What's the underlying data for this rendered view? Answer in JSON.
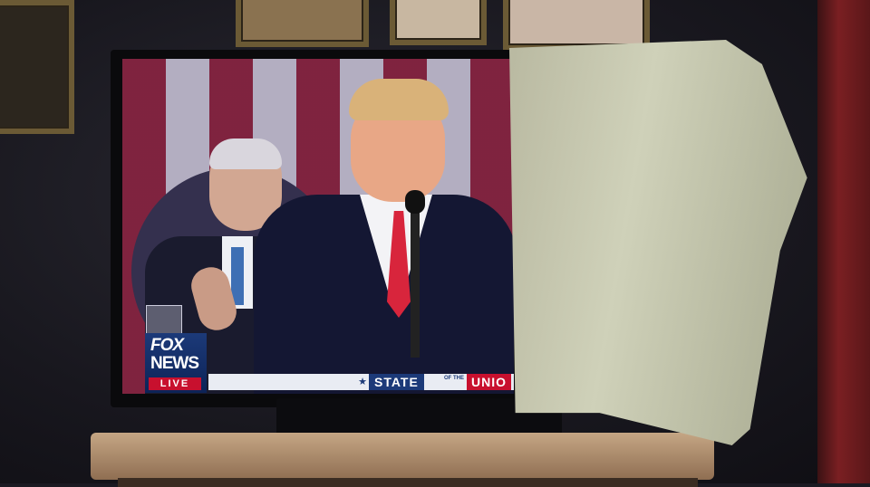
{
  "scene": {
    "description_colors": {
      "wall": "#1b1a22",
      "towel": "#c4c6ad",
      "shelf": "#b89a78",
      "accent_red": "#c8102e",
      "fox_blue": "#1c3a79"
    }
  },
  "broadcast": {
    "logo_line1": "FOX",
    "logo_line2": "NEWS",
    "logo_badge": "LIVE",
    "ticker_star": "★",
    "ticker_word1": "STATE",
    "ticker_of": "OF THE",
    "ticker_word2": "UNIO"
  }
}
